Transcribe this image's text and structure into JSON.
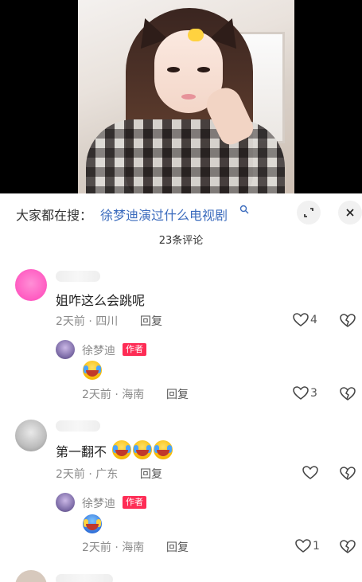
{
  "search": {
    "prefix": "大家都在搜：",
    "query": "徐梦迪演过什么电视剧"
  },
  "comments_count": "23条评论",
  "comments": [
    {
      "text": "姐咋这么会跳呢",
      "time": "2天前",
      "location": "四川",
      "reply_label": "回复",
      "likes": "4",
      "reply": {
        "author": "徐梦迪",
        "badge": "作者",
        "emoji": "laughing-crying-emoji",
        "time": "2天前",
        "location": "海南",
        "reply_label": "回复",
        "likes": "3"
      }
    },
    {
      "text": "第一翻不",
      "time": "2天前",
      "location": "广东",
      "reply_label": "回复",
      "likes": "",
      "reply": {
        "author": "徐梦迪",
        "badge": "作者",
        "emoji": "crying-emoji",
        "time": "2天前",
        "location": "海南",
        "reply_label": "回复",
        "likes": "1"
      }
    }
  ],
  "separator": "·",
  "colors": {
    "link": "#3b6bbd",
    "badge": "#fe2c55",
    "meta": "#8a8a8a"
  }
}
